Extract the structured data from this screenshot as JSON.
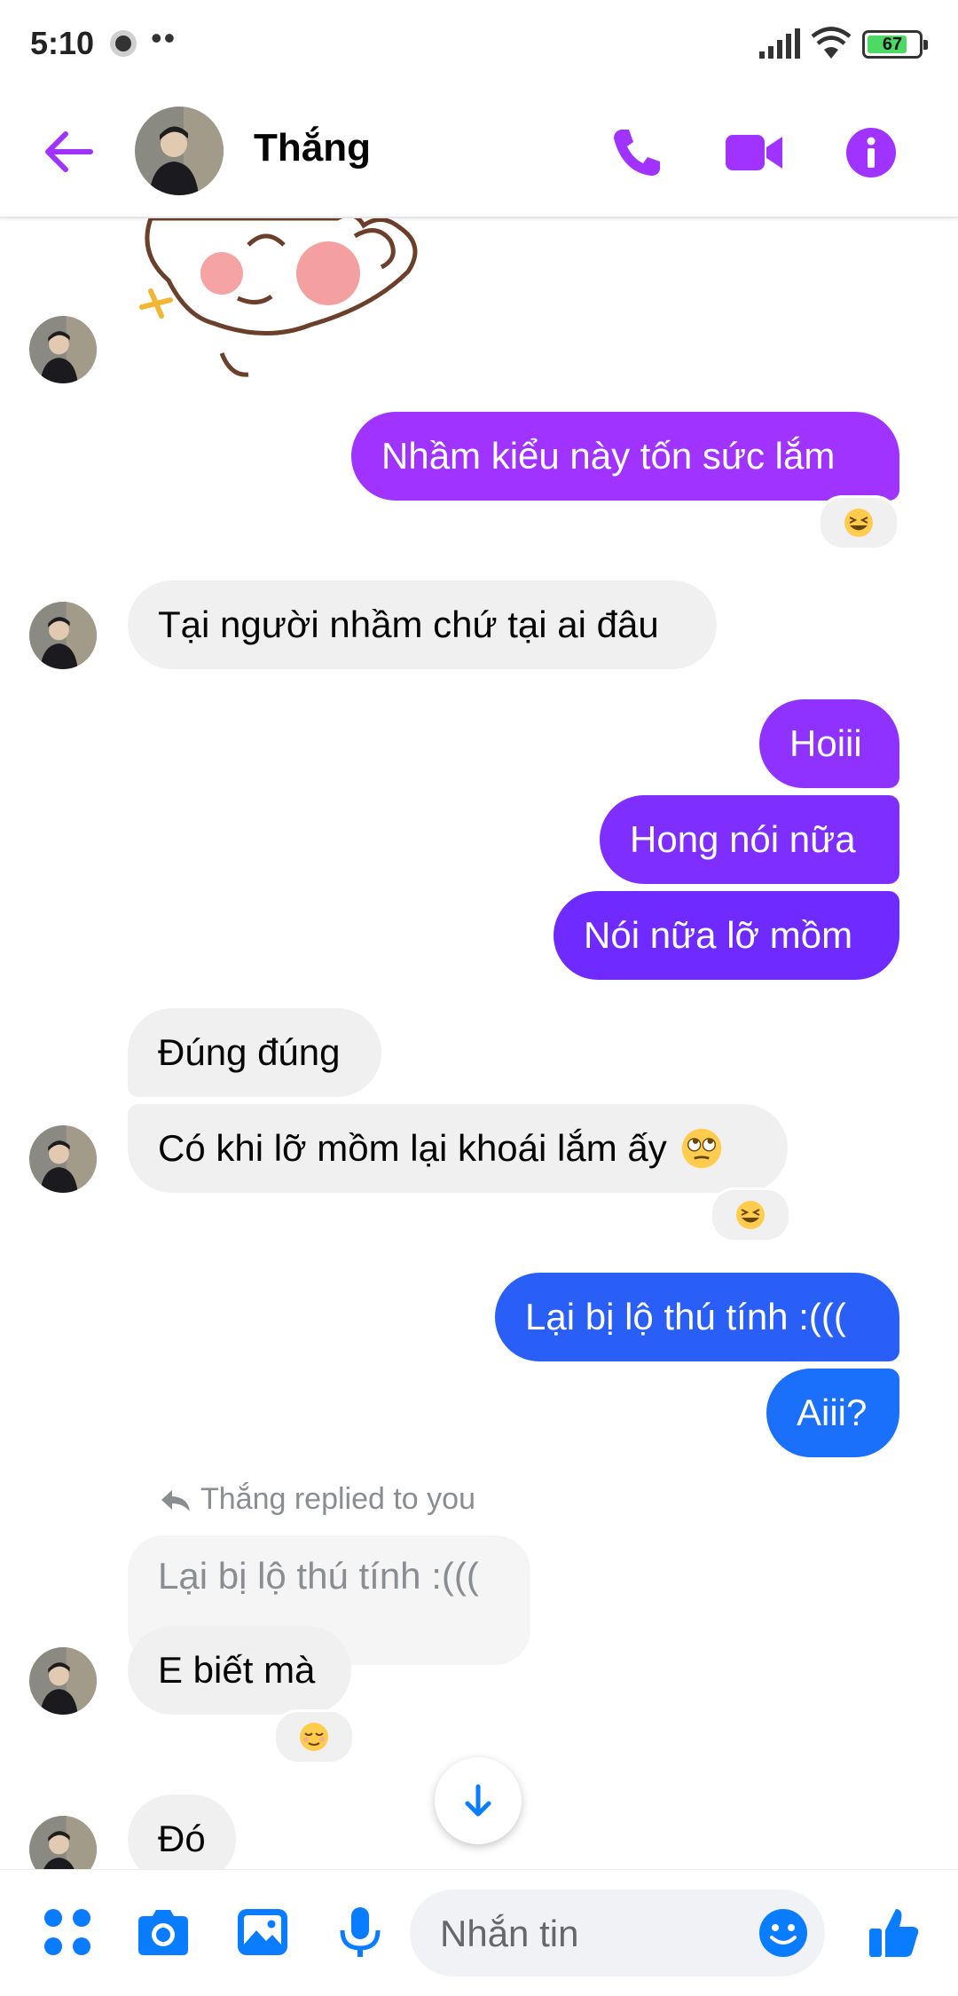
{
  "status_bar": {
    "time": "5:10",
    "dots": "••",
    "battery_level": "67"
  },
  "header": {
    "contact_name": "Thắng"
  },
  "colors": {
    "accent": "#a033ff",
    "purple": "#a033ff",
    "violet": "#6f2bff",
    "blue": "#0a7cff",
    "incoming": "#f0f0f0"
  },
  "messages": [
    {
      "id": "m1",
      "side": "out",
      "text": "Nhầm kiểu này tốn sức lắm",
      "reaction": "laughing-emoji"
    },
    {
      "id": "m2",
      "side": "in",
      "text": "Tại người nhầm chứ tại ai đâu"
    },
    {
      "id": "m3",
      "side": "out",
      "text": "Hoiii"
    },
    {
      "id": "m4",
      "side": "out",
      "text": "Hong nói nữa"
    },
    {
      "id": "m5",
      "side": "out",
      "text": "Nói nữa lỡ mồm"
    },
    {
      "id": "m6",
      "side": "in",
      "text": "Đúng đúng"
    },
    {
      "id": "m7",
      "side": "in",
      "text": "Có khi lỡ mồm lại khoái lắm ấy",
      "reaction": "laughing-emoji"
    },
    {
      "id": "m8",
      "side": "out",
      "text": "Lại bị lộ thú tính :((("
    },
    {
      "id": "m9",
      "side": "out",
      "text": "Aiii?"
    },
    {
      "id": "m10",
      "side": "in",
      "text": "E biết mà",
      "reaction": "relieved-emoji"
    },
    {
      "id": "m11",
      "side": "in",
      "text": "Đó"
    }
  ],
  "reply": {
    "note": "Thắng replied to you",
    "quoted_text": "Lại bị lộ thú tính :((("
  },
  "composer": {
    "placeholder": "Nhắn tin"
  }
}
